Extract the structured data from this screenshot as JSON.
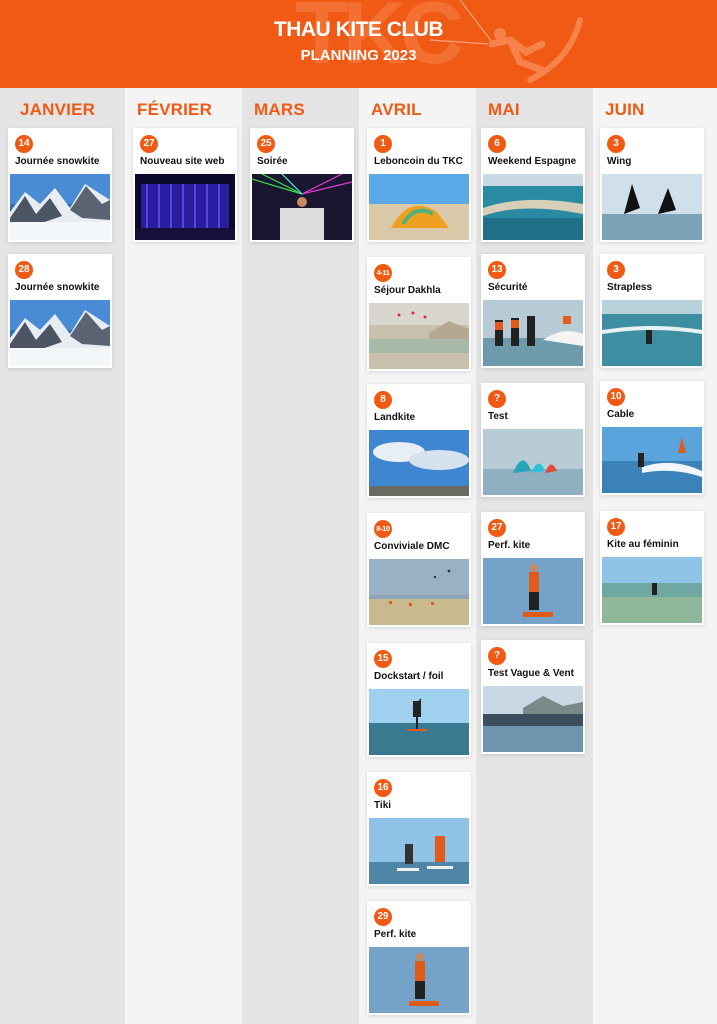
{
  "header": {
    "title": "THAU KITE CLUB",
    "subtitle": "PLANNING 2023",
    "background_color": "#f05a14"
  },
  "months": [
    {
      "name": "JANVIER",
      "events": [
        {
          "date": "14",
          "title": "Journée snowkite",
          "photo": "snow-mountain-photo"
        },
        {
          "date": "28",
          "title": "Journée snowkite",
          "photo": "snow-mountain-photo"
        }
      ]
    },
    {
      "name": "FÉVRIER",
      "events": [
        {
          "date": "27",
          "title": "Nouveau site web",
          "photo": "stage-curtain-photo"
        }
      ]
    },
    {
      "name": "MARS",
      "events": [
        {
          "date": "25",
          "title": "Soirée",
          "photo": "dj-party-photo"
        }
      ]
    },
    {
      "name": "AVRIL",
      "events": [
        {
          "date": "1",
          "title": "Leboncoin du TKC",
          "photo": "kite-on-beach-photo"
        },
        {
          "date": "4-11",
          "title": "Séjour Dakhla",
          "photo": "desert-lagoon-photo"
        },
        {
          "date": "8",
          "title": "Landkite",
          "photo": "cloudy-sky-photo"
        },
        {
          "date": "8-10",
          "title": "Conviviale DMC",
          "photo": "beach-kites-photo"
        },
        {
          "date": "15",
          "title": "Dockstart / foil",
          "photo": "foil-rider-photo"
        },
        {
          "date": "16",
          "title": "Tiki",
          "photo": "two-kiters-photo"
        },
        {
          "date": "29",
          "title": "Perf. kite",
          "photo": "kiter-jump-photo"
        }
      ]
    },
    {
      "name": "MAI",
      "events": [
        {
          "date": "6",
          "title": "Weekend Espagne",
          "photo": "aerial-coast-photo"
        },
        {
          "date": "13",
          "title": "Sécurité",
          "photo": "group-water-photo"
        },
        {
          "date": "?",
          "title": "Test",
          "photo": "wing-foil-photo"
        },
        {
          "date": "27",
          "title": "Perf. kite",
          "photo": "kiter-jump-photo"
        },
        {
          "date": "?",
          "title": "Test Vague & Vent",
          "photo": "crowded-beach-photo"
        }
      ]
    },
    {
      "name": "JUIN",
      "events": [
        {
          "date": "3",
          "title": "Wing",
          "photo": "wing-foil-photo"
        },
        {
          "date": "3",
          "title": "Strapless",
          "photo": "strapless-wave-photo"
        },
        {
          "date": "10",
          "title": "Cable",
          "photo": "cable-ski-photo"
        },
        {
          "date": "17",
          "title": "Kite au féminin",
          "photo": "shallow-water-photo"
        }
      ]
    }
  ]
}
